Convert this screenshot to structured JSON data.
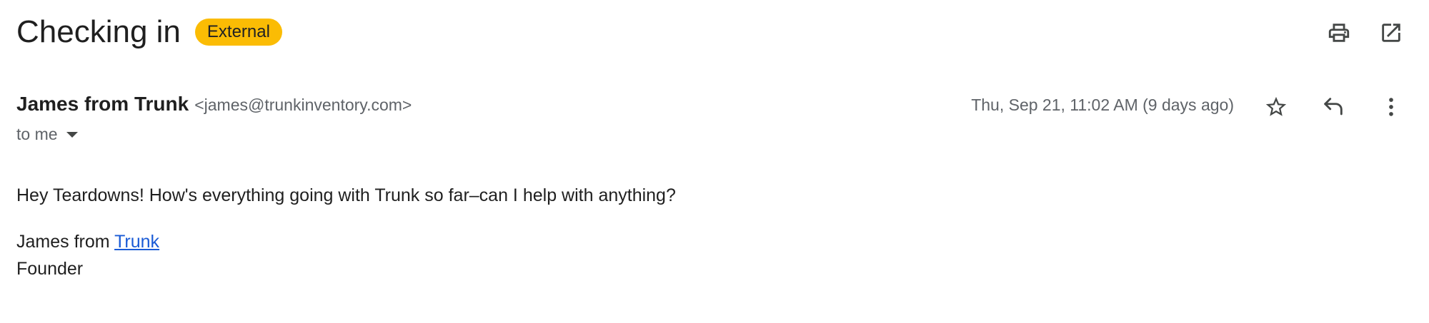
{
  "subject": "Checking in",
  "badge": "External",
  "toolbar": {
    "print_icon": "printer-icon",
    "popout_icon": "open-in-new-window-icon"
  },
  "message": {
    "sender_name": "James from Trunk",
    "sender_email": "<james@trunkinventory.com>",
    "recipient_label": "to me",
    "date": "Thu, Sep 21, 11:02 AM (9 days ago)",
    "actions": {
      "star_icon": "star-icon",
      "reply_icon": "reply-icon",
      "more_icon": "more-vert-icon"
    },
    "body": {
      "greeting": "Hey Teardowns! How's everything going with Trunk so far–can I help with anything?",
      "sig_prefix": "James from ",
      "sig_link": "Trunk",
      "sig_title": "Founder"
    }
  },
  "colors": {
    "badge": "#fbbc04",
    "link": "#1a5bd6",
    "muted": "#5f6368"
  }
}
